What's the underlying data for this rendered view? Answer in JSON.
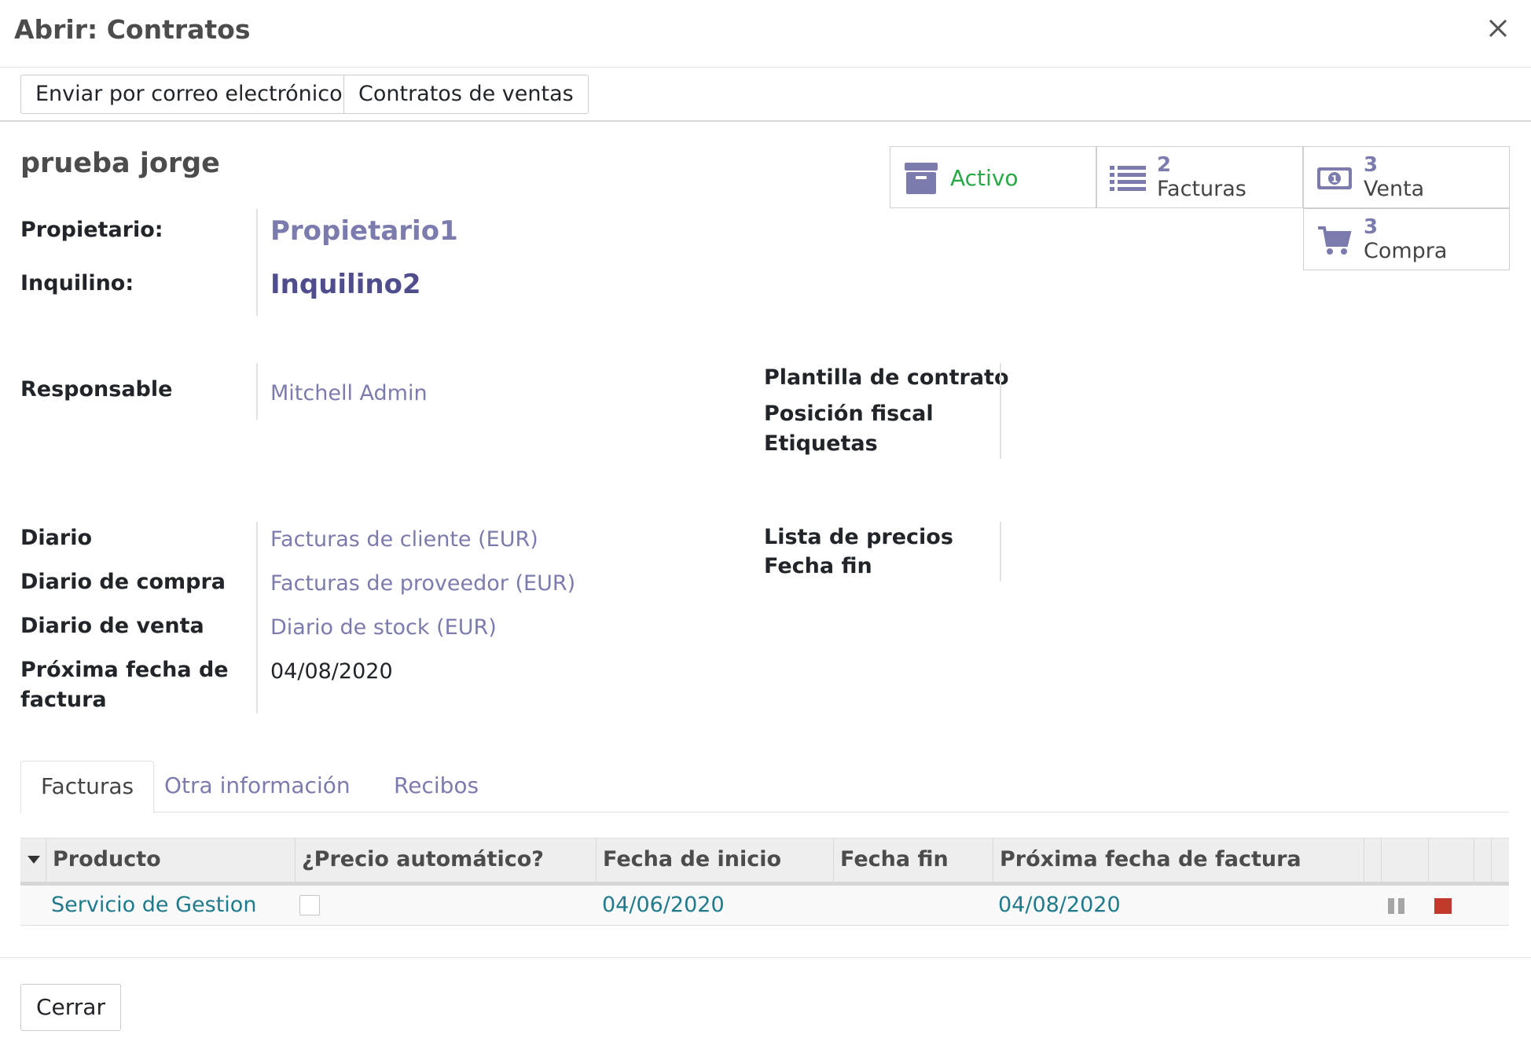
{
  "dialog": {
    "title": "Abrir: Contratos"
  },
  "statusbar": {
    "send_email_label": "Enviar por correo electrónico",
    "sale_contracts_label": "Contratos de ventas"
  },
  "record": {
    "name": "prueba jorge"
  },
  "smart_buttons": {
    "active": {
      "label": "Activo",
      "color": "#28a745"
    },
    "invoices": {
      "count": "2",
      "label": "Facturas"
    },
    "sale": {
      "count": "3",
      "label": "Venta"
    },
    "purchase": {
      "count": "3",
      "label": "Compra"
    }
  },
  "fields": {
    "owner": {
      "label": "Propietario:",
      "value": "Propietario1"
    },
    "tenant": {
      "label": "Inquilino:",
      "value": "Inquilino2"
    },
    "responsible": {
      "label": "Responsable",
      "value": "Mitchell Admin"
    },
    "contract_template": {
      "label": "Plantilla de contrato"
    },
    "fiscal_position": {
      "label": "Posición fiscal"
    },
    "tags": {
      "label": "Etiquetas"
    },
    "journal": {
      "label": "Diario",
      "value": "Facturas de cliente (EUR)"
    },
    "purchase_journal": {
      "label": "Diario de compra",
      "value": "Facturas de proveedor (EUR)"
    },
    "sale_journal": {
      "label": "Diario de venta",
      "value": "Diario de stock (EUR)"
    },
    "next_invoice_date": {
      "label_line1": "Próxima fecha de",
      "label_line2": "factura",
      "value": "04/08/2020"
    },
    "pricelist": {
      "label": "Lista de precios"
    },
    "end_date": {
      "label": "Fecha fin"
    }
  },
  "tabs": [
    {
      "label": "Facturas",
      "active": true
    },
    {
      "label": "Otra información",
      "active": false
    },
    {
      "label": "Recibos",
      "active": false
    }
  ],
  "grid": {
    "columns": [
      "Producto",
      "¿Precio automático?",
      "Fecha de inicio",
      "Fecha fin",
      "Próxima fecha de factura"
    ],
    "rows": [
      {
        "product": "Servicio de Gestion",
        "auto_price": false,
        "start_date": "04/06/2020",
        "end_date": "",
        "next_invoice_date": "04/08/2020"
      }
    ]
  },
  "footer": {
    "close_label": "Cerrar"
  },
  "colors": {
    "link": "#7c7bad",
    "link_dark": "#4f4d8c",
    "row_link": "#1f7a8c",
    "stop": "#c0392b",
    "pause": "#a6a6a6"
  }
}
